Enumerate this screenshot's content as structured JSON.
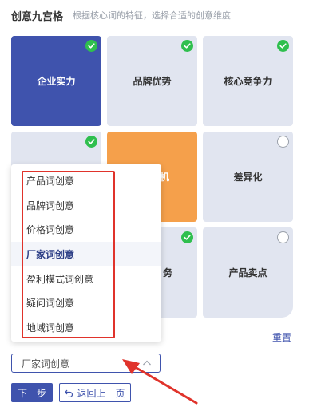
{
  "header": {
    "title": "创意九宫格",
    "subtitle": "根据核心词的特征，选择合适的创意维度"
  },
  "grid": {
    "cells": [
      {
        "label": "企业实力",
        "state": "checked",
        "selected": true
      },
      {
        "label": "品牌优势",
        "state": "checked",
        "selected": false
      },
      {
        "label": "核心竞争力",
        "state": "checked",
        "selected": false
      },
      {
        "label": "",
        "state": "checked",
        "selected": false
      },
      {
        "label": "机",
        "state": "none",
        "selected": false
      },
      {
        "label": "差异化",
        "state": "unchecked",
        "selected": false
      },
      {
        "label": "",
        "state": "none",
        "selected": false
      },
      {
        "label": "务",
        "state": "checked",
        "selected": false
      },
      {
        "label": "产品卖点",
        "state": "unchecked",
        "selected": false
      }
    ]
  },
  "reset_label": "重置",
  "dropdown": {
    "options": [
      "产品词创意",
      "品牌词创意",
      "价格词创意",
      "厂家词创意",
      "盈利模式词创意",
      "疑问词创意",
      "地域词创意"
    ],
    "active_index": 3
  },
  "select": {
    "value": "厂家词创意"
  },
  "buttons": {
    "next": "下一步",
    "back": "返回上一页"
  },
  "colors": {
    "accent": "#3f53ad",
    "cell_bg": "#e1e5f0",
    "check_green": "#2fbf4e",
    "orange": "#f5a04b",
    "annotation_red": "#e0332b"
  }
}
